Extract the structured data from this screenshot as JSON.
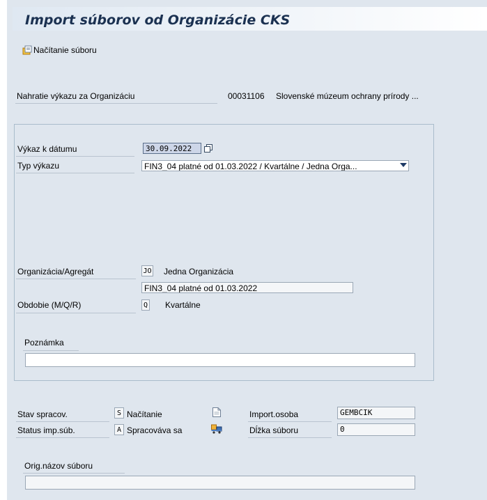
{
  "window": {
    "title": "Import súborov od Organizácie CKS"
  },
  "toolbar": {
    "load_label": "Načítanie súboru"
  },
  "organization": {
    "label": "Nahratie výkazu za Organizáciu",
    "id": "00031106",
    "name": "Slovenské múzeum ochrany prírody ..."
  },
  "form": {
    "report_date_label": "Výkaz k dátumu",
    "report_date_value": "30.09.2022",
    "report_type_label": "Typ výkazu",
    "report_type_value": "FIN3_04 platné od 01.03.2022 / Kvartálne / Jedna Orga...",
    "org_aggregate_label": "Organizácia/Agregát",
    "org_aggregate_code": "JO",
    "org_aggregate_text": "Jedna Organizácia",
    "report_desc_value": "FIN3_04 platné od 01.03.2022",
    "period_label": "Obdobie (M/Q/R)",
    "period_code": "Q",
    "period_text": "Kvartálne",
    "note_label": "Poznámka",
    "note_value": ""
  },
  "status": {
    "processing_label": "Stav spracov.",
    "processing_code": "S",
    "processing_text": "Načítanie",
    "import_status_label": "Status imp.súb.",
    "import_status_code": "A",
    "import_status_text": "Spracováva sa",
    "import_person_label": "Import.osoba",
    "import_person_value": "GEMBCIK",
    "file_length_label": "Dĺžka súboru",
    "file_length_value": "0"
  },
  "file": {
    "orig_name_label": "Orig.názov súboru",
    "orig_name_value": ""
  },
  "icons": {
    "toolbar": "load-file-icon",
    "date_help": "copy-icon",
    "doc": "document-icon",
    "truck": "truck-icon"
  },
  "colors": {
    "title": "#1b3151",
    "background": "#dfe6ee",
    "accent": "#1e3a66"
  }
}
